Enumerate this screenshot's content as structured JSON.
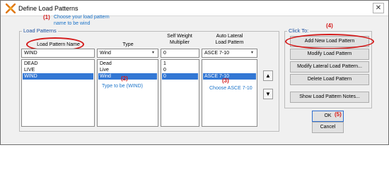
{
  "window": {
    "title": "Define Load Patterns",
    "close_glyph": "✕"
  },
  "annotations": {
    "step1_num": "(1)",
    "step1_text_line1": "Choose your load pattern",
    "step1_text_line2": "name to be wind",
    "step2_num": "(2)",
    "step2_text": "Type to be (WIND)",
    "step3_num": "(3)",
    "step3_text": "Choose ASCE 7-10",
    "step4_num": "(4)",
    "step5_num": "(5)"
  },
  "load_patterns": {
    "legend": "Load Patterns",
    "headers": {
      "name": "Load Pattern Name",
      "type": "Type",
      "self_weight_line1": "Self Weight",
      "self_weight_line2": "Multiplier",
      "auto_lateral_line1": "Auto Lateral",
      "auto_lateral_line2": "Load Pattern"
    },
    "inputs": {
      "name_value": "WIND",
      "type_value": "Wind",
      "multiplier_value": "0",
      "auto_lateral_value": "ASCE 7-10"
    },
    "names": [
      "DEAD",
      "LIVE",
      "WIND"
    ],
    "types": [
      "Dead",
      "Live",
      "Wind"
    ],
    "multipliers": [
      "1",
      "0",
      "0"
    ],
    "auto_lateral": [
      "",
      "",
      "ASCE 7-10"
    ],
    "selected_index": 2,
    "move_up_glyph": "▲",
    "move_down_glyph": "▼"
  },
  "click_to": {
    "legend": "Click To:",
    "buttons": {
      "add_new": "Add New Load Pattern",
      "modify": "Modify Load Pattern",
      "modify_lateral": "Modify Lateral Load Pattern...",
      "delete": "Delete Load Pattern",
      "show_notes": "Show Load Pattern Notes..."
    }
  },
  "footer": {
    "ok": "OK",
    "cancel": "Cancel"
  },
  "colors": {
    "annotation_blue": "#1a73c9",
    "annotation_red": "#d41a1a",
    "selection": "#3377d4"
  }
}
